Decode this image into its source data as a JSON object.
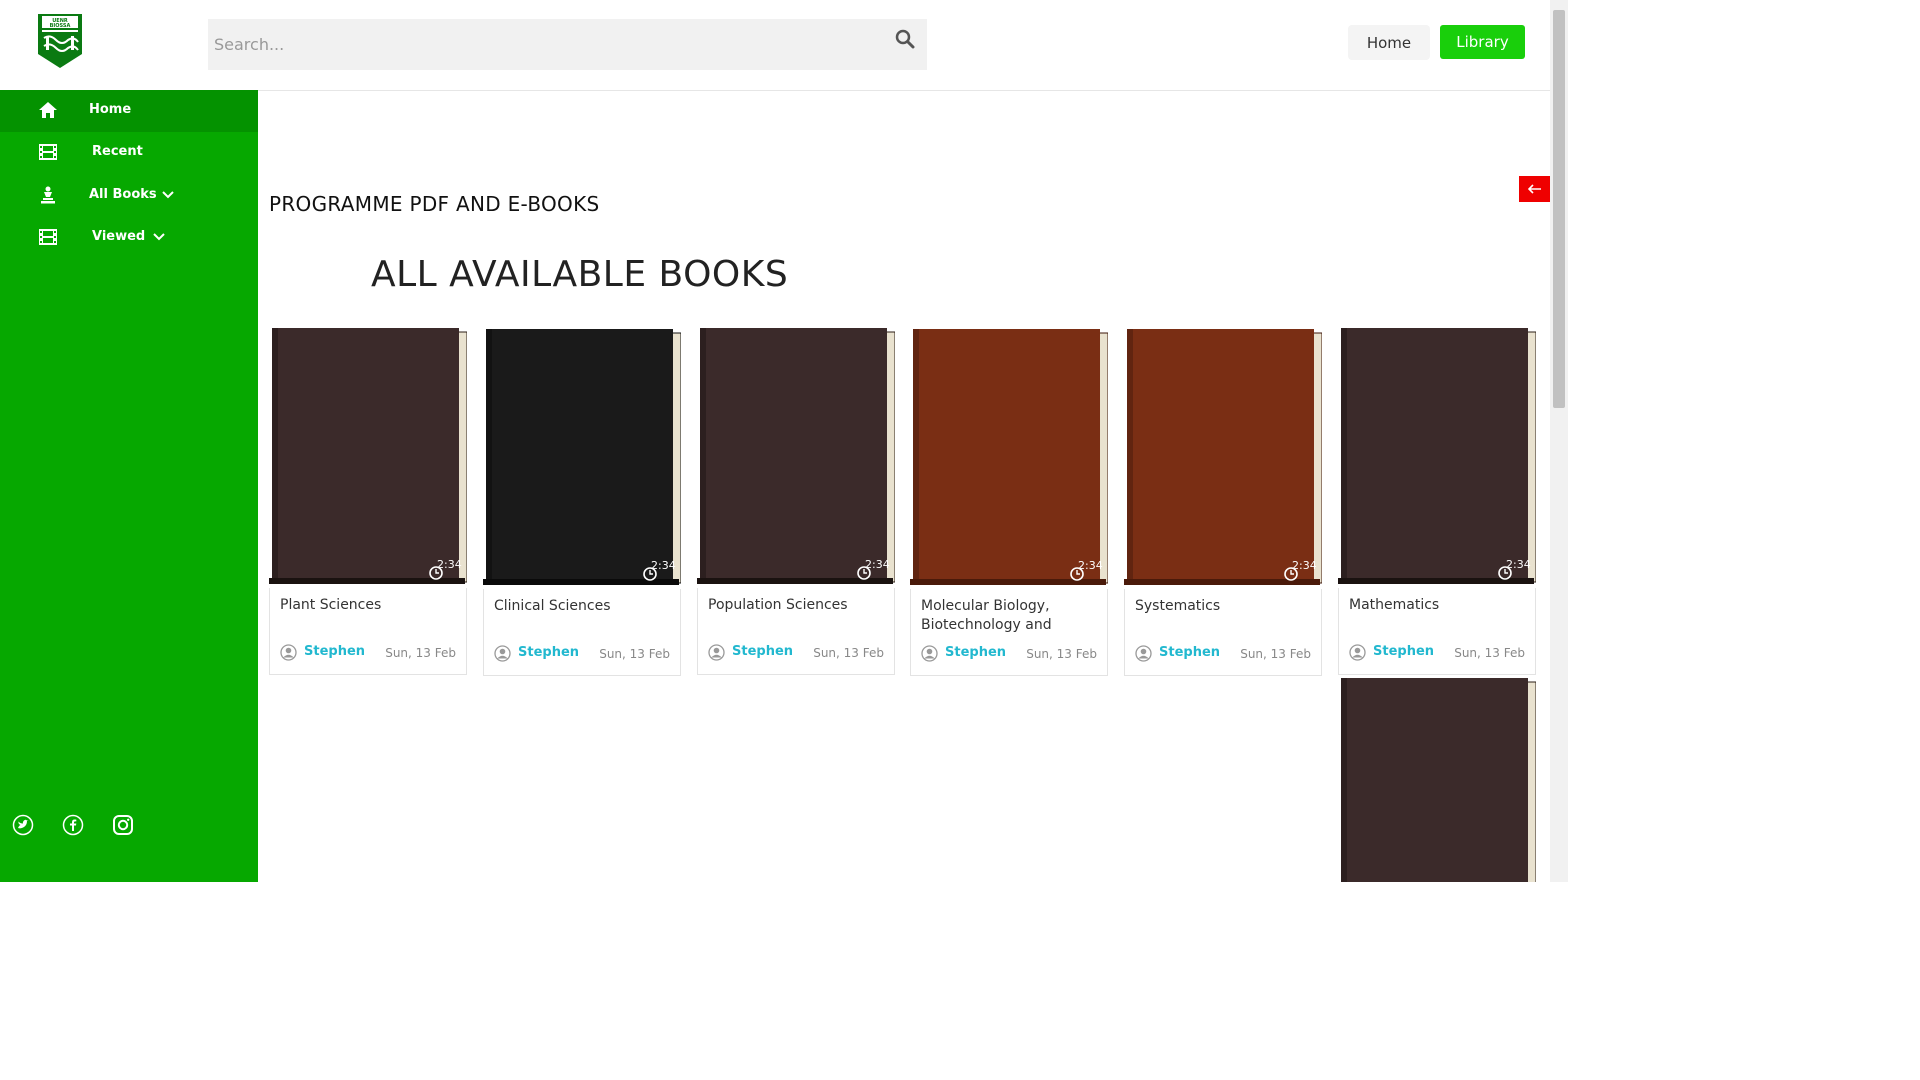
{
  "logo": {
    "text_top": "UENR",
    "text_bottom": "BIOSSA"
  },
  "search": {
    "placeholder": "Search..."
  },
  "header": {
    "home_label": "Home",
    "library_label": "Library"
  },
  "sidebar": {
    "items": [
      {
        "label": "Home",
        "icon": "home-icon"
      },
      {
        "label": "Recent",
        "icon": "film-icon"
      },
      {
        "label": "All Books",
        "icon": "chess-icon"
      },
      {
        "label": "Viewed",
        "icon": "film-icon"
      }
    ],
    "social": [
      "twitter-icon",
      "facebook-icon",
      "instagram-icon"
    ]
  },
  "main": {
    "section_title": "PROGRAMME PDF AND E-BOOKS",
    "heading": "ALL AVAILABLE BOOKS",
    "books": [
      {
        "title": "Plant Sciences",
        "author": "Stephen",
        "date": "Sun, 13 Feb",
        "time": "2:34",
        "color": "#3b2a2a"
      },
      {
        "title": "Clinical Sciences",
        "author": "Stephen",
        "date": "Sun, 13 Feb",
        "time": "2:34",
        "color": "#1a1a1a"
      },
      {
        "title": "Population Sciences",
        "author": "Stephen",
        "date": "Sun, 13 Feb",
        "time": "2:34",
        "color": "#3b2a2a"
      },
      {
        "title": "Molecular Biology, Biotechnology and",
        "author": "Stephen",
        "date": "Sun, 13 Feb",
        "time": "2:34",
        "color": "#7a2e14"
      },
      {
        "title": "Systematics",
        "author": "Stephen",
        "date": "Sun, 13 Feb",
        "time": "2:34",
        "color": "#7a2e14"
      },
      {
        "title": "Mathematics",
        "author": "Stephen",
        "date": "Sun, 13 Feb",
        "time": "2:34",
        "color": "#3b2a2a"
      }
    ]
  },
  "colors": {
    "sidebar": "#06a800",
    "accent": "#19cf0b",
    "author": "#22b8cf",
    "back_button": "#ef0000"
  }
}
